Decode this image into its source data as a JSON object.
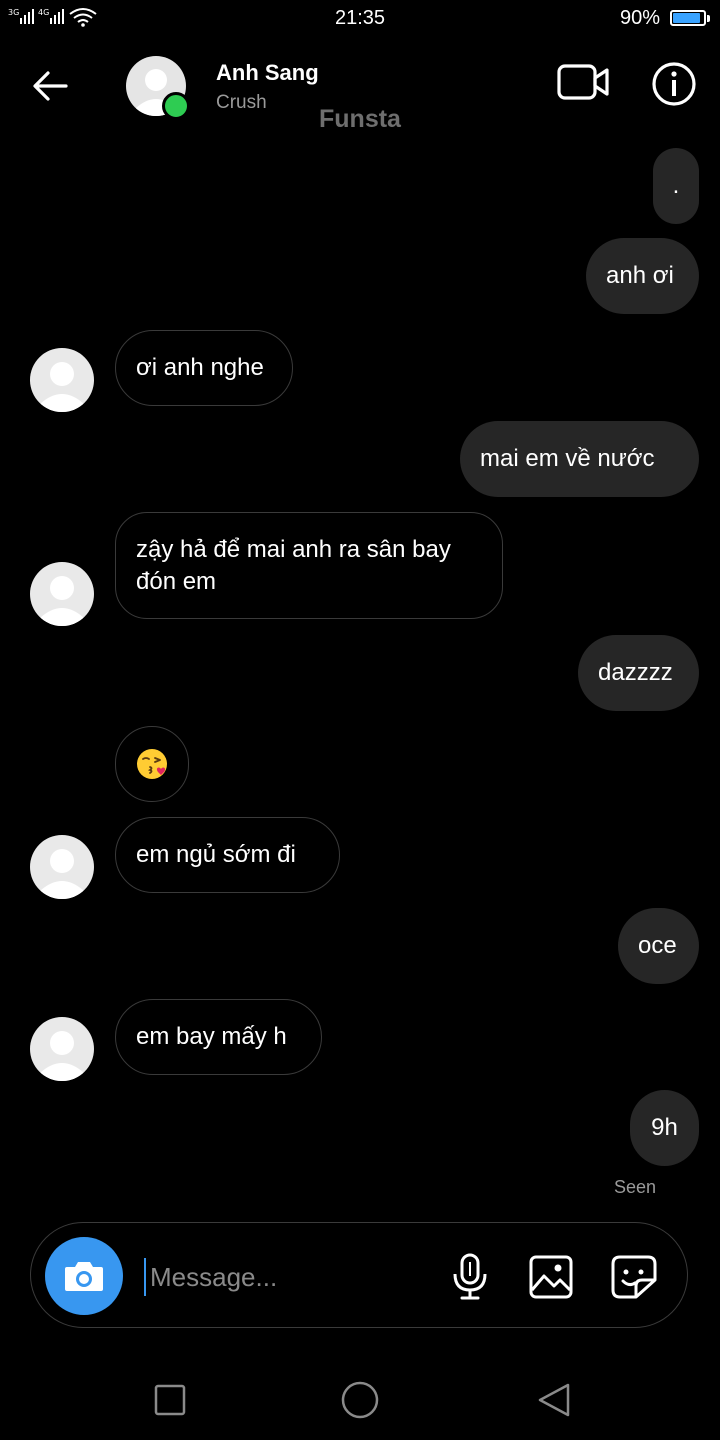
{
  "status_bar": {
    "signal": "3G 4G",
    "time": "21:35",
    "battery_pct": "90%",
    "battery_level": 0.9
  },
  "header": {
    "contact_name": "Anh Sang",
    "contact_subtitle": "Crush",
    "account_label": "Funsta",
    "online": true
  },
  "messages": [
    {
      "dir": "out",
      "text": "."
    },
    {
      "dir": "out",
      "text": "anh ơi"
    },
    {
      "dir": "in",
      "text": "ơi anh nghe"
    },
    {
      "dir": "out",
      "text": "mai em về nước"
    },
    {
      "dir": "in",
      "text": "zậy hả để mai anh ra sân bay đón em"
    },
    {
      "dir": "out",
      "text": "dazzzz"
    },
    {
      "dir": "in",
      "emoji": "kissing-face-with-heart"
    },
    {
      "dir": "in",
      "text": "em ngủ sớm đi"
    },
    {
      "dir": "out",
      "text": "oce"
    },
    {
      "dir": "in",
      "text": "em bay mấy h"
    },
    {
      "dir": "out",
      "text": "9h"
    }
  ],
  "seen_label": "Seen",
  "composer": {
    "placeholder": "Message..."
  },
  "colors": {
    "background": "#000000",
    "outgoing_bubble": "#262626",
    "incoming_border": "#3a3a3a",
    "camera_button": "#3897f0",
    "online_dot": "#2ecc52",
    "battery_fill": "#3aa3ff"
  },
  "icons": [
    "back-arrow-icon",
    "video-camera-icon",
    "info-icon",
    "camera-icon",
    "microphone-icon",
    "image-icon",
    "sticker-icon",
    "nav-recents-icon",
    "nav-home-icon",
    "nav-back-icon"
  ]
}
